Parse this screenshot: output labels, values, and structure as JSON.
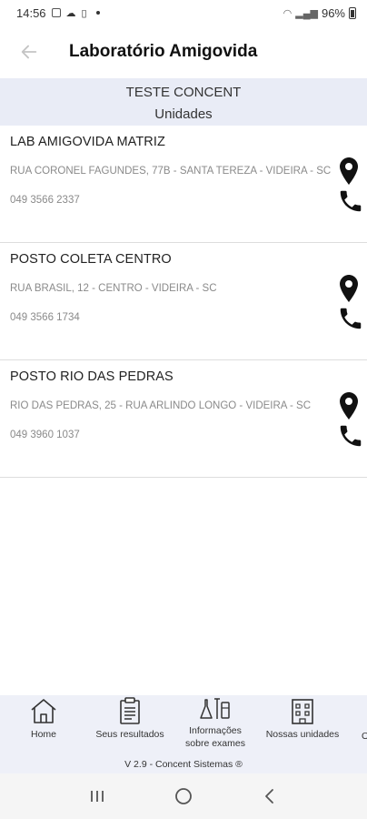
{
  "status_bar": {
    "time": "14:56",
    "battery": "96%"
  },
  "header": {
    "title": "Laboratório Amigovida"
  },
  "subheader": {
    "client": "TESTE CONCENT",
    "section": "Unidades"
  },
  "units": [
    {
      "name": "LAB AMIGOVIDA MATRIZ",
      "address": "RUA CORONEL FAGUNDES, 77B - SANTA TEREZA - VIDEIRA - SC",
      "phone": "049 3566 2337"
    },
    {
      "name": "POSTO COLETA CENTRO",
      "address": "RUA BRASIL, 12 - CENTRO - VIDEIRA - SC",
      "phone": "049 3566 1734"
    },
    {
      "name": "POSTO RIO DAS PEDRAS",
      "address": "RIO DAS PEDRAS, 25 - RUA ARLINDO LONGO - VIDEIRA - SC",
      "phone": "049 3960 1037"
    }
  ],
  "bottom_nav": {
    "items": [
      {
        "label": "Home",
        "icon": "home-icon"
      },
      {
        "label": "Seus resultados",
        "icon": "clipboard-icon"
      },
      {
        "label": "Informações sobre exames",
        "icon": "lab-flasks-icon"
      },
      {
        "label": "Nossas unidades",
        "icon": "building-icon"
      }
    ],
    "version": "V 2.9 - Concent Sistemas ®"
  }
}
